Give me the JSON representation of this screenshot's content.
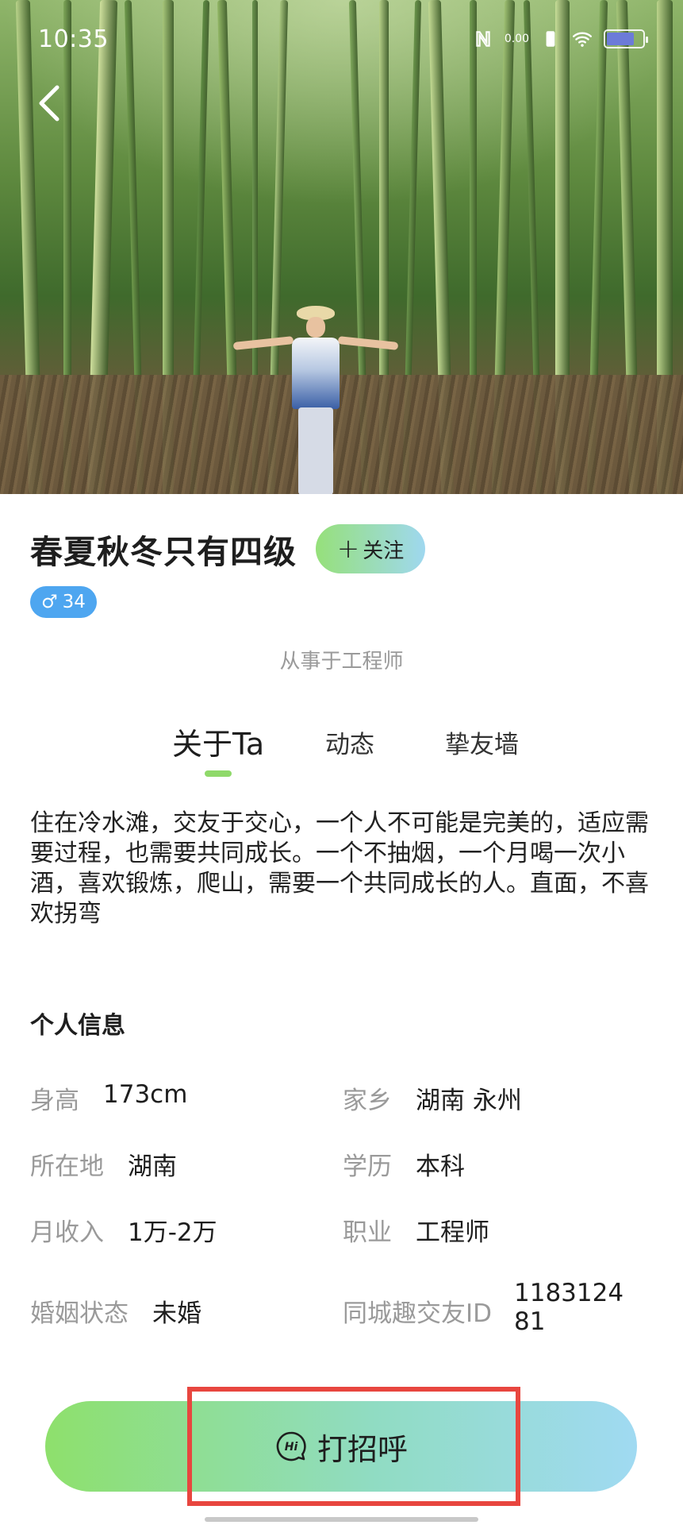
{
  "status_bar": {
    "time": "10:35",
    "net_speed": "0.00",
    "battery_level": 0.8
  },
  "profile": {
    "nickname": "春夏秋冬只有四级",
    "follow_label": "关注",
    "gender_symbol": "♂",
    "age": "34",
    "occupation_line": "从事于工程师"
  },
  "tabs": [
    {
      "label": "关于Ta",
      "active": true
    },
    {
      "label": "动态",
      "active": false
    },
    {
      "label": "挚友墙",
      "active": false
    }
  ],
  "bio": "住在冷水滩，交友于交心，一个人不可能是完美的，适应需要过程，也需要共同成长。一个不抽烟，一个月喝一次小酒，喜欢锻炼，爬山，需要一个共同成长的人。直面，不喜欢拐弯",
  "personal_info": {
    "title": "个人信息",
    "items": [
      {
        "label": "身高",
        "value": "173cm"
      },
      {
        "label": "家乡",
        "value": "湖南 永州"
      },
      {
        "label": "所在地",
        "value": "湖南"
      },
      {
        "label": "学历",
        "value": "本科"
      },
      {
        "label": "月收入",
        "value": "1万-2万"
      },
      {
        "label": "职业",
        "value": "工程师"
      },
      {
        "label": "婚姻状态",
        "value": "未婚"
      },
      {
        "label": "同城趣交友ID",
        "value": "118312481"
      }
    ]
  },
  "cta": {
    "greet_label": "打招呼",
    "greet_icon_text": "Hi"
  },
  "colors": {
    "accent_green": "#8ee06c",
    "accent_blue": "#a0daf2",
    "badge_blue": "#4ea6f0",
    "highlight_red": "#e8463f"
  }
}
